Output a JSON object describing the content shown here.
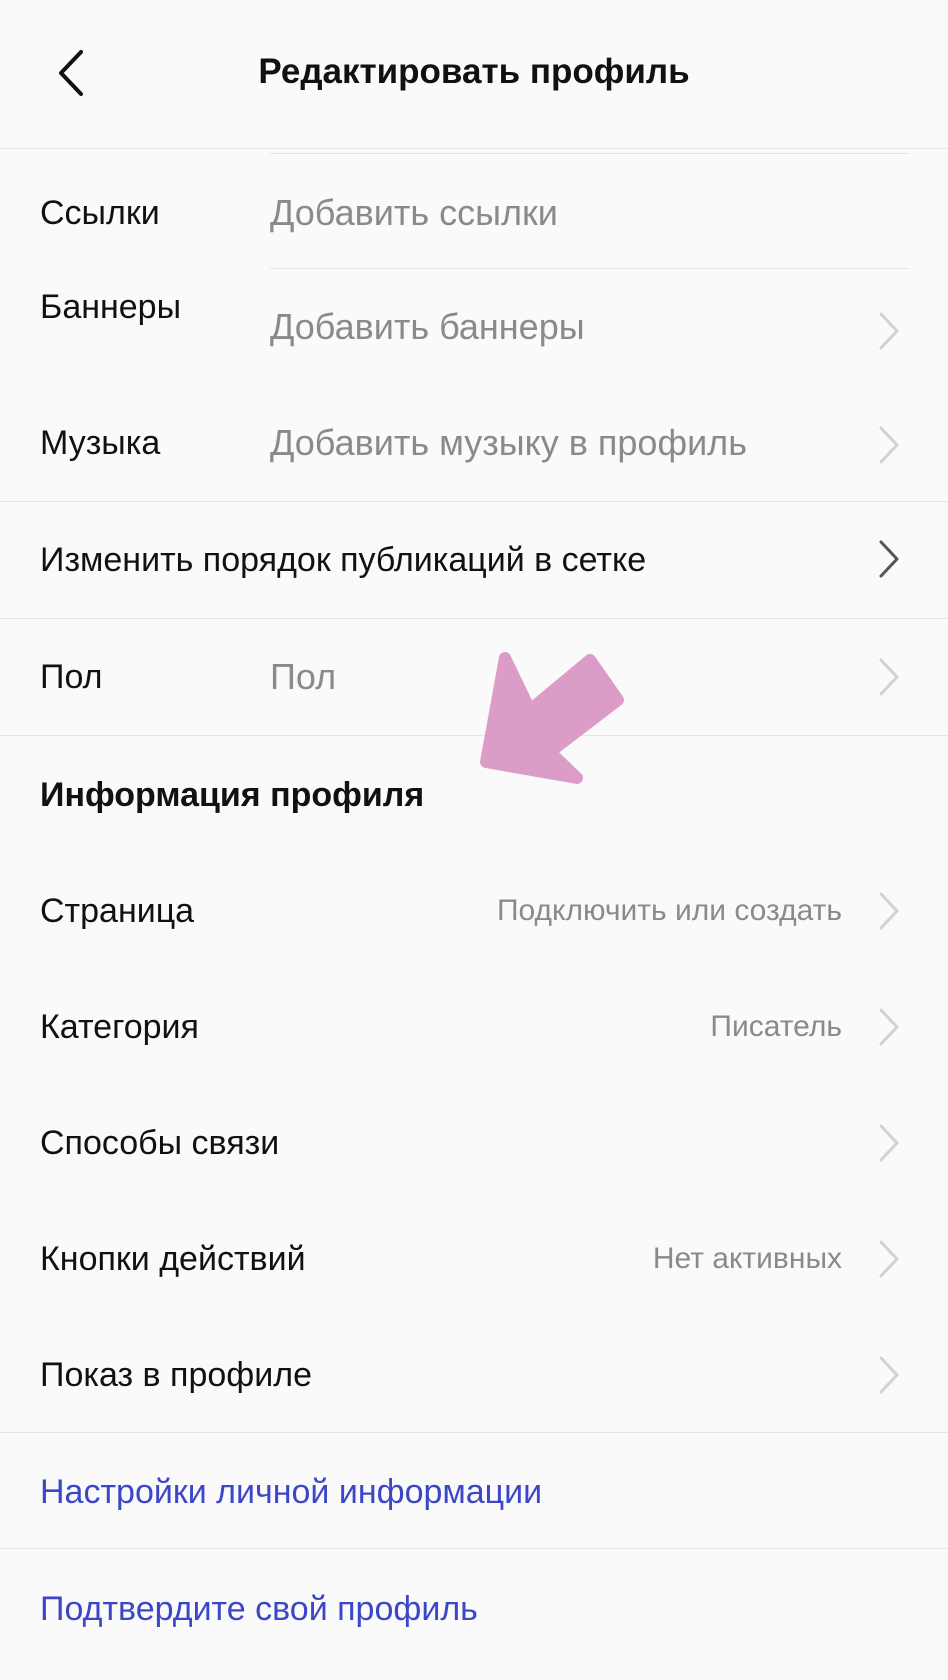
{
  "header": {
    "title": "Редактировать профиль",
    "back_icon": "chevron-left-icon"
  },
  "profile_fields": [
    {
      "label": "Ссылки",
      "value": "Добавить ссылки"
    },
    {
      "label": "Баннеры",
      "value": "Добавить баннеры"
    },
    {
      "label": "Музыка",
      "value": "Добавить музыку в профиль"
    }
  ],
  "grid_order": {
    "label": "Изменить порядок публикаций в сетке"
  },
  "gender": {
    "label": "Пол",
    "value": "Пол"
  },
  "profile_info": {
    "heading": "Информация профиля",
    "items": [
      {
        "label": "Страница",
        "value": "Подключить или создать"
      },
      {
        "label": "Категория",
        "value": "Писатель"
      },
      {
        "label": "Способы связи",
        "value": ""
      },
      {
        "label": "Кнопки действий",
        "value": "Нет активных"
      },
      {
        "label": "Показ в профиле",
        "value": ""
      }
    ]
  },
  "links": {
    "personal_info": "Настройки личной информации",
    "verify_profile": "Подтвердите свой профиль"
  },
  "colors": {
    "link": "#3b47c8",
    "annotation_arrow": "#dc9cc8",
    "secondary_text": "#8a8a8e"
  }
}
